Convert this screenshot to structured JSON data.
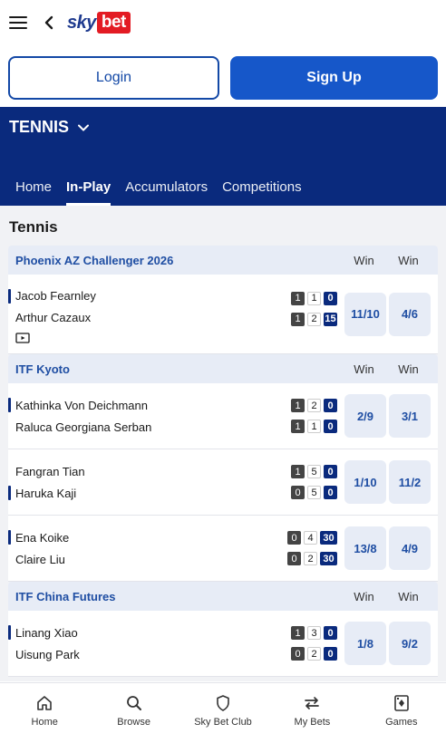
{
  "brand": {
    "sky": "sky",
    "bet": "bet"
  },
  "auth": {
    "login_label": "Login",
    "signup_label": "Sign Up"
  },
  "hero": {
    "title": "TENNIS"
  },
  "tabs": [
    {
      "label": "Home"
    },
    {
      "label": "In-Play"
    },
    {
      "label": "Accumulators"
    },
    {
      "label": "Competitions"
    }
  ],
  "section_title": "Tennis",
  "competitions": [
    {
      "name": "Phoenix AZ Challenger 2026",
      "win1": "Win",
      "win2": "Win",
      "matches": [
        {
          "p1": "Jacob Fearnley",
          "p2": "Arthur Cazaux",
          "s1": [
            "1",
            "1",
            "0"
          ],
          "s2": [
            "1",
            "2",
            "15"
          ],
          "o1": "11/10",
          "o2": "4/6"
        }
      ]
    },
    {
      "name": "ITF Kyoto",
      "win1": "Win",
      "win2": "Win",
      "matches": [
        {
          "p1": "Kathinka Von Deichmann",
          "p2": "Raluca Georgiana Serban",
          "s1": [
            "1",
            "2",
            "0"
          ],
          "s2": [
            "1",
            "1",
            "0"
          ],
          "o1": "2/9",
          "o2": "3/1"
        },
        {
          "p1": "Fangran Tian",
          "p2": "Haruka Kaji",
          "s1": [
            "1",
            "5",
            "0"
          ],
          "s2": [
            "0",
            "5",
            "0"
          ],
          "o1": "1/10",
          "o2": "11/2"
        },
        {
          "p1": "Ena Koike",
          "p2": "Claire Liu",
          "s1": [
            "0",
            "4",
            "30"
          ],
          "s2": [
            "0",
            "2",
            "30"
          ],
          "o1": "13/8",
          "o2": "4/9"
        }
      ]
    },
    {
      "name": "ITF China Futures",
      "win1": "Win",
      "win2": "Win",
      "matches": [
        {
          "p1": "Linang Xiao",
          "p2": "Uisung Park",
          "s1": [
            "1",
            "3",
            "0"
          ],
          "s2": [
            "0",
            "2",
            "0"
          ],
          "o1": "1/8",
          "o2": "9/2"
        }
      ]
    }
  ],
  "nav": [
    {
      "label": "Home",
      "icon": "home-icon"
    },
    {
      "label": "Browse",
      "icon": "search-icon"
    },
    {
      "label": "Sky Bet Club",
      "icon": "shield-icon"
    },
    {
      "label": "My Bets",
      "icon": "swap-icon"
    },
    {
      "label": "Games",
      "icon": "cards-icon"
    }
  ]
}
